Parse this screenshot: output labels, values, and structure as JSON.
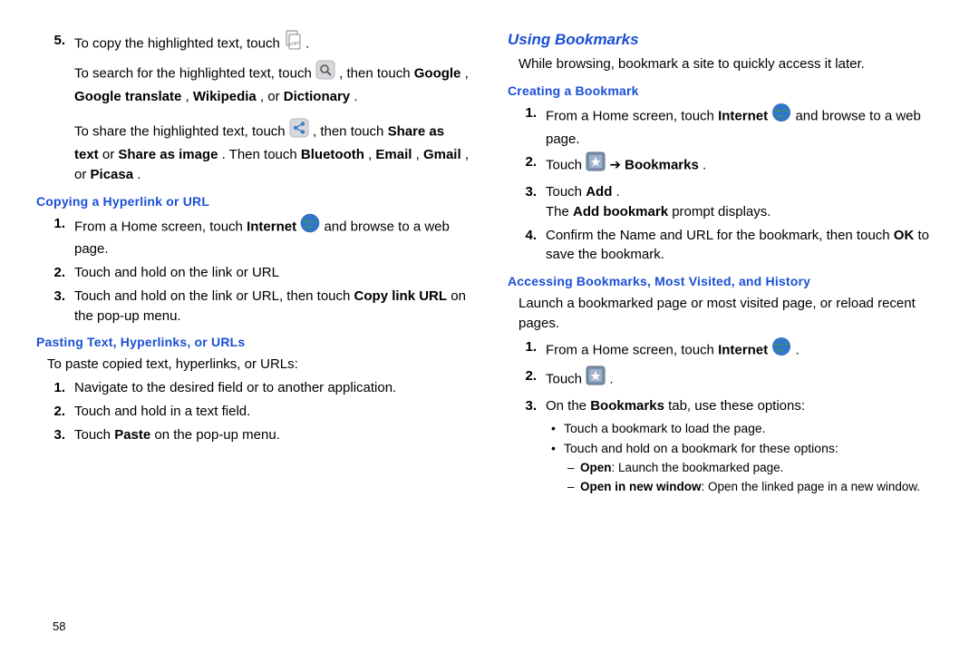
{
  "left": {
    "item5": {
      "num": "5.",
      "p1a": "To copy the highlighted text, touch ",
      "p1b": " .",
      "p2a": "To search for the highlighted text, touch ",
      "p2b": " , then touch ",
      "bold1": "Google",
      "p2c": ", ",
      "bold2": "Google translate",
      "p2d": ", ",
      "bold3": "Wikipedia",
      "p2e": ", or ",
      "bold4": "Dictionary",
      "p2f": ".",
      "p3a": "To share the highlighted text, touch ",
      "p3b": " , then touch ",
      "bold5": "Share as text",
      "p3c": " or ",
      "bold6": "Share as image",
      "p3d": ". Then touch ",
      "bold7": "Bluetooth",
      "p3e": ", ",
      "bold8": "Email",
      "p3f": ", ",
      "bold9": "Gmail",
      "p3g": ", or ",
      "bold10": "Picasa",
      "p3h": "."
    },
    "sub1": "Copying a Hyperlink or URL",
    "c1": {
      "n1": "1.",
      "t1a": "From a Home screen, touch ",
      "t1b": "Internet",
      "t1c": " and browse to a web page.",
      "n2": "2.",
      "t2": "Touch and hold on the link or URL",
      "n3": "3.",
      "t3a": "Touch and hold on the link or URL, then touch ",
      "t3b": "Copy link URL",
      "t3c": " on the pop-up menu."
    },
    "sub2": "Pasting Text, Hyperlinks, or URLs",
    "pintro": "To paste copied text, hyperlinks, or URLs:",
    "c2": {
      "n1": "1.",
      "t1": "Navigate to the desired field or to another application.",
      "n2": "2.",
      "t2": "Touch and hold in a text field.",
      "n3": "3.",
      "t3a": "Touch ",
      "t3b": "Paste",
      "t3c": " on the pop-up menu."
    }
  },
  "right": {
    "section": "Using Bookmarks",
    "intro": "While browsing, bookmark a site to quickly access it later.",
    "sub1": "Creating a Bookmark",
    "b1": {
      "n1": "1.",
      "t1a": "From a Home screen, touch ",
      "t1b": "Internet",
      "t1c": " and browse to a web page.",
      "n2": "2.",
      "t2a": "Touch ",
      "t2b": " ➔ ",
      "t2c": "Bookmarks",
      "t2d": ".",
      "n3": "3.",
      "t3a": "Touch ",
      "t3b": "Add",
      "t3c": ".",
      "t3d": "The ",
      "t3e": "Add bookmark",
      "t3f": " prompt displays.",
      "n4": "4.",
      "t4a": "Confirm the Name and URL for the bookmark, then touch ",
      "t4b": "OK",
      "t4c": " to save the bookmark."
    },
    "sub2": "Accessing Bookmarks, Most Visited, and History",
    "intro2": "Launch a bookmarked page or most visited page, or reload recent pages.",
    "b2": {
      "n1": "1.",
      "t1a": "From a Home screen, touch ",
      "t1b": "Internet",
      "t1c": " .",
      "n2": "2.",
      "t2a": "Touch ",
      "t2b": " .",
      "n3": "3.",
      "t3a": "On the ",
      "t3b": "Bookmarks",
      "t3c": " tab, use these options:"
    },
    "bullets": {
      "b1": "Touch a bookmark to load the page.",
      "b2": "Touch and hold on a bookmark for these options:",
      "d1a": "Open",
      "d1b": ": Launch the bookmarked page.",
      "d2a": "Open in new window",
      "d2b": ": Open the linked page in a new window."
    }
  },
  "pageNum": "58"
}
